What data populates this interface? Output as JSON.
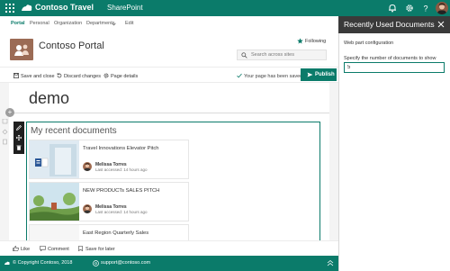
{
  "suite_bar": {
    "brand": "Contoso Travel",
    "app": "SharePoint",
    "icons": [
      "waffle-icon",
      "contoso-logo-icon",
      "bell-icon",
      "gear-icon",
      "help-icon",
      "user-avatar"
    ]
  },
  "nav": {
    "items": [
      "Portal",
      "Personal",
      "Organization",
      "Departments",
      "Edit"
    ],
    "active": "Portal"
  },
  "site": {
    "title": "Contoso Portal",
    "following": "Following",
    "search_placeholder": "Search across sites"
  },
  "command_bar": {
    "save_close": "Save and close",
    "discard": "Discard changes",
    "page_details": "Page details",
    "saved_status": "Your page has been saved",
    "publish": "Publish"
  },
  "page": {
    "title": "demo"
  },
  "webpart": {
    "title": "My recent documents",
    "documents": [
      {
        "title": "Travel Innovations Elevator Pitch",
        "author": "Melissa Torres",
        "accessed": "Last accessed: 14 hours ago"
      },
      {
        "title": "NEW PRODUCTs SALES PITCH",
        "author": "Melissa Torres",
        "accessed": "Last accessed: 14 hours ago"
      },
      {
        "title": "East Region Quarterly Sales",
        "author": "",
        "accessed": ""
      }
    ]
  },
  "social_bar": {
    "like": "Like",
    "comment": "Comment",
    "save_later": "Save for later"
  },
  "footer": {
    "copyright": "© Copyright Contoso, 2018",
    "email": "support@contoso.com"
  },
  "panel": {
    "title": "Recently Used Documents",
    "section": "Web part configuration",
    "field_label": "Specify the number of documents to show",
    "field_value": "5"
  },
  "colors": {
    "brand": "#0b7b6a",
    "panel_header": "#3a3a3a"
  }
}
